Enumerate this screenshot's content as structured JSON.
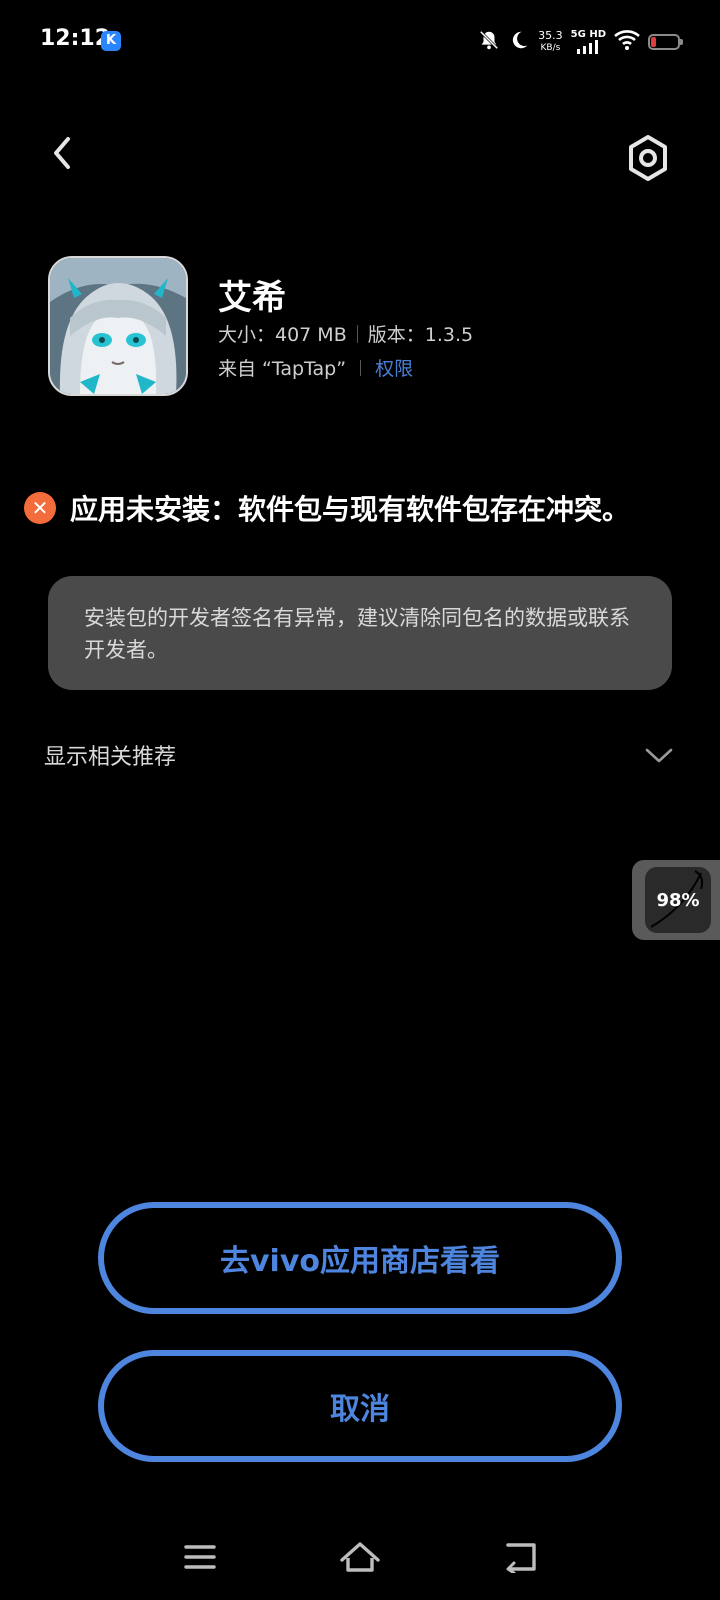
{
  "status_bar": {
    "time": "12:12",
    "k_badge": "K",
    "net_speed_value": "35.3",
    "net_speed_unit": "KB/s",
    "network_label": "5G HD"
  },
  "app": {
    "name": "艾希",
    "size_label": "大小：407 MB",
    "version_label": "版本：1.3.5",
    "source_label": "来自 “TapTap”",
    "permissions_link": "权限"
  },
  "error": {
    "icon_glyph": "✕",
    "message": "应用未安装：软件包与现有软件包存在冲突。"
  },
  "notice": {
    "text": "安装包的开发者签名有异常，建议清除同包名的数据或联系开发者。"
  },
  "related": {
    "label": "显示相关推荐"
  },
  "floating_widget": {
    "label": "98%"
  },
  "buttons": {
    "store_label": "去vivo应用商店看看",
    "cancel_label": "取消"
  },
  "colors": {
    "accent": "#4e86df",
    "error": "#f26c3c",
    "card_bg": "#4a4a4a",
    "battery_low": "#e23b3b"
  },
  "icons": {
    "back": "chevron-left-icon",
    "settings": "settings-hexagon-icon",
    "expand": "chevron-down-icon",
    "nav_menu": "menu-icon",
    "nav_home": "home-icon",
    "nav_back": "return-icon"
  }
}
